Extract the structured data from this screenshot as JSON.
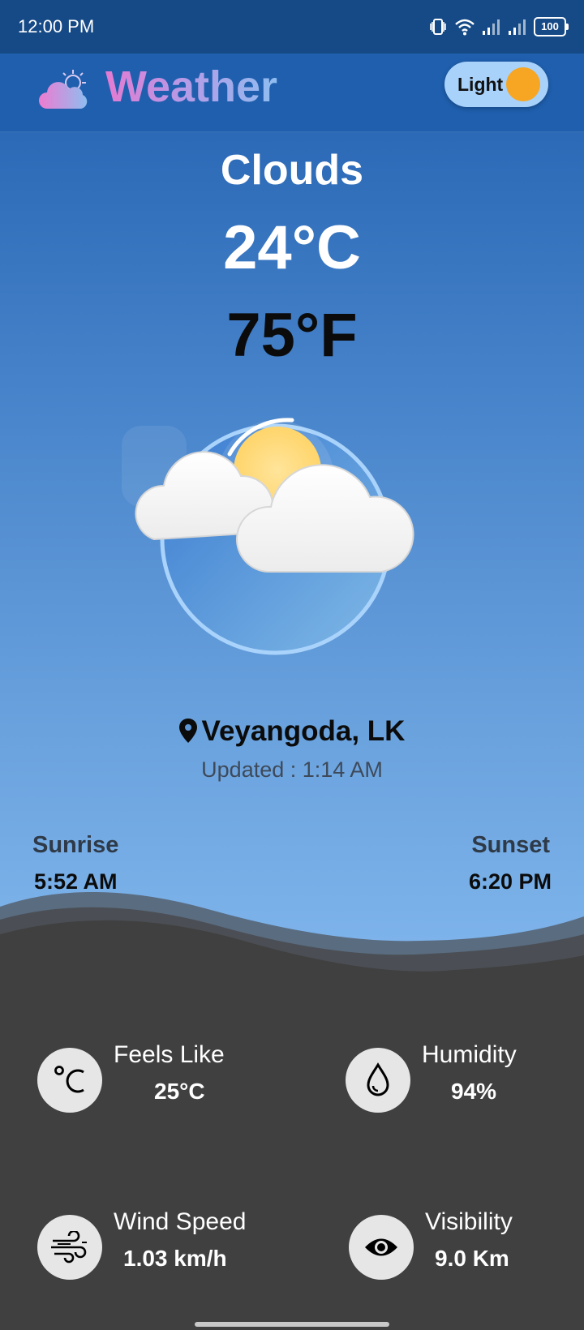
{
  "status_bar": {
    "time": "12:00 PM",
    "battery": "100"
  },
  "app": {
    "title": "Weather",
    "theme_toggle_label": "Light"
  },
  "weather": {
    "condition": "Clouds",
    "temp_c": "24°C",
    "temp_f": "75°F",
    "location": "Veyangoda, LK",
    "updated_label": "Updated : ",
    "updated_time": "1:14 AM"
  },
  "sun": {
    "sunrise_label": "Sunrise",
    "sunrise_time": "5:52 AM",
    "sunset_label": "Sunset",
    "sunset_time": "6:20 PM"
  },
  "stats": {
    "feels_like": {
      "label": "Feels Like",
      "value": "25°C",
      "icon": "thermometer-celsius-icon"
    },
    "humidity": {
      "label": "Humidity",
      "value": "94%",
      "icon": "water-drop-icon"
    },
    "wind_speed": {
      "label": "Wind Speed",
      "value": "1.03 km/h",
      "icon": "wind-icon"
    },
    "visibility": {
      "label": "Visibility",
      "value": "9.0 Km",
      "icon": "eye-icon"
    }
  },
  "colors": {
    "status_bar": "#164a86",
    "app_bar": "#1f5fae",
    "bottom_panel": "#404040",
    "toggle_bg": "#a8d2fa",
    "toggle_knob": "#f6a623"
  }
}
